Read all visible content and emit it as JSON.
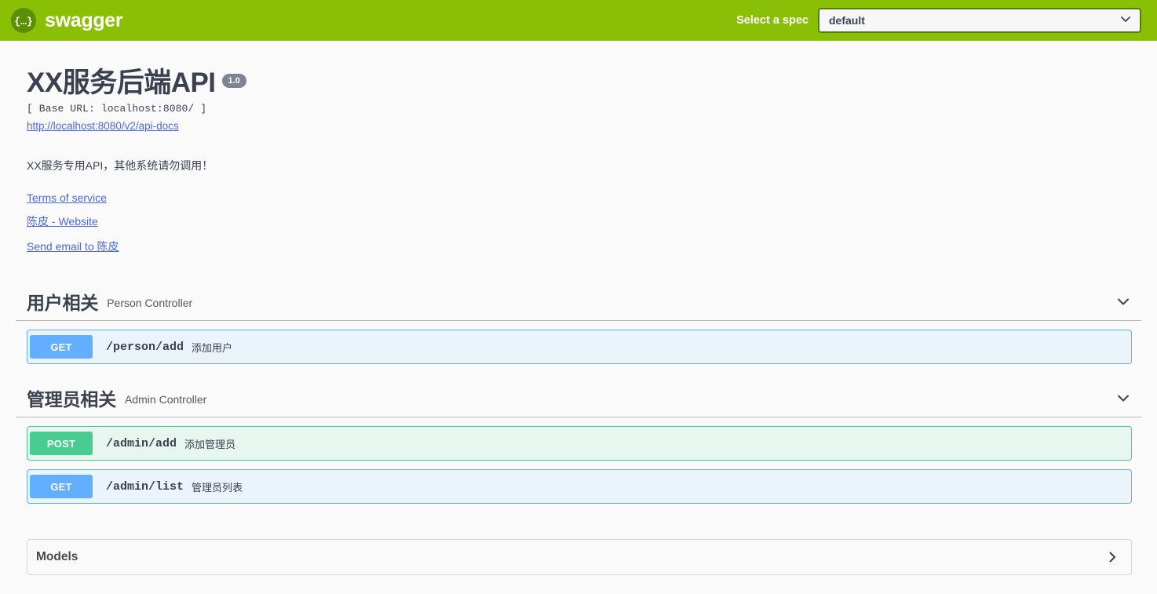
{
  "topbar": {
    "logo_text": "swagger",
    "logo_icon": "swagger-braces-icon",
    "spec_label": "Select a spec",
    "spec_selected": "default",
    "spec_options": [
      "default"
    ],
    "bar_color": "#89bf04",
    "logo_circle_color": "#5b8f00"
  },
  "info": {
    "title": "XX服务后端API",
    "version": "1.0",
    "base_url": "[ Base URL: localhost:8080/ ]",
    "api_docs_url": "http://localhost:8080/v2/api-docs",
    "description": "XX服务专用API，其他系统请勿调用！",
    "links": [
      {
        "label": "Terms of service"
      },
      {
        "label": "陈皮 - Website"
      },
      {
        "label": "Send email to 陈皮"
      }
    ]
  },
  "tags": [
    {
      "name": "用户相关",
      "description": "Person Controller",
      "expanded": true,
      "arrow_icon": "chevron-down-icon",
      "operations": [
        {
          "method": "GET",
          "method_color": "#61affe",
          "bg_color": "#ebf3fb",
          "path": "/person/add",
          "summary": "添加用户"
        }
      ]
    },
    {
      "name": "管理员相关",
      "description": "Admin Controller",
      "expanded": true,
      "arrow_icon": "chevron-down-icon",
      "operations": [
        {
          "method": "POST",
          "method_color": "#49cc90",
          "bg_color": "#e8f6f0",
          "path": "/admin/add",
          "summary": "添加管理员"
        },
        {
          "method": "GET",
          "method_color": "#61affe",
          "bg_color": "#ebf3fb",
          "path": "/admin/list",
          "summary": "管理员列表"
        }
      ]
    }
  ],
  "models": {
    "title": "Models",
    "expanded": false,
    "arrow_icon": "chevron-right-icon"
  }
}
